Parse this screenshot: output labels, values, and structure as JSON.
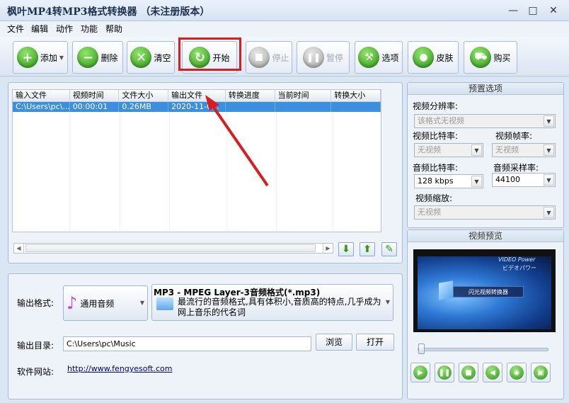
{
  "window": {
    "title": "枫叶MP4转MP3格式转换器 （未注册版本）",
    "minimize": "—",
    "maximize": "□",
    "close": "✕"
  },
  "menu": [
    "文件",
    "编辑",
    "动作",
    "功能",
    "帮助"
  ],
  "toolbar": {
    "add": "添加",
    "delete": "删除",
    "clear": "清空",
    "start": "开始",
    "stop": "停止",
    "pause": "暂停",
    "options": "选项",
    "skin": "皮肤",
    "buy": "购买"
  },
  "table": {
    "columns": [
      "输入文件",
      "视频时间",
      "文件大小",
      "输出文件",
      "转换进度",
      "当前时间",
      "转换大小"
    ],
    "rows": [
      [
        "C:\\Users\\pc\\...",
        "00:00:01",
        "0.26MB",
        "2020-11-0...",
        "",
        "",
        ""
      ]
    ]
  },
  "presets": {
    "title": "预置选项",
    "video_resolution_label": "视频分辨率:",
    "video_resolution_value": "该格式无视频",
    "video_bitrate_label": "视频比特率:",
    "video_bitrate_value": "无视频",
    "video_fps_label": "视频帧率:",
    "video_fps_value": "无视频",
    "audio_bitrate_label": "音频比特率:",
    "audio_bitrate_value": "128 kbps",
    "audio_samplerate_label": "音频采样率:",
    "audio_samplerate_value": "44100",
    "video_scale_label": "视频缩放:",
    "video_scale_value": "无视频"
  },
  "preview": {
    "title": "视频预览",
    "brand_top": "VIDEO Power",
    "brand_bottom": "ビデオパワー",
    "app_banner": "闪光视频转换器"
  },
  "output": {
    "format_label": "输出格式:",
    "format_category": "通用音频",
    "format_name": "MP3 - MPEG Layer-3音频格式(*.mp3)",
    "format_desc": "最流行的音频格式,具有体积小,音质高的特点,几乎成为网上音乐的代名词",
    "dir_label": "输出目录:",
    "dir_value": "C:\\Users\\pc\\Music",
    "browse": "浏览",
    "open": "打开",
    "site_label": "软件网站:",
    "site_url": "http://www.fengyesoft.com"
  },
  "colors": {
    "accent": "#3b8fdd",
    "highlight": "#d71d1d"
  }
}
